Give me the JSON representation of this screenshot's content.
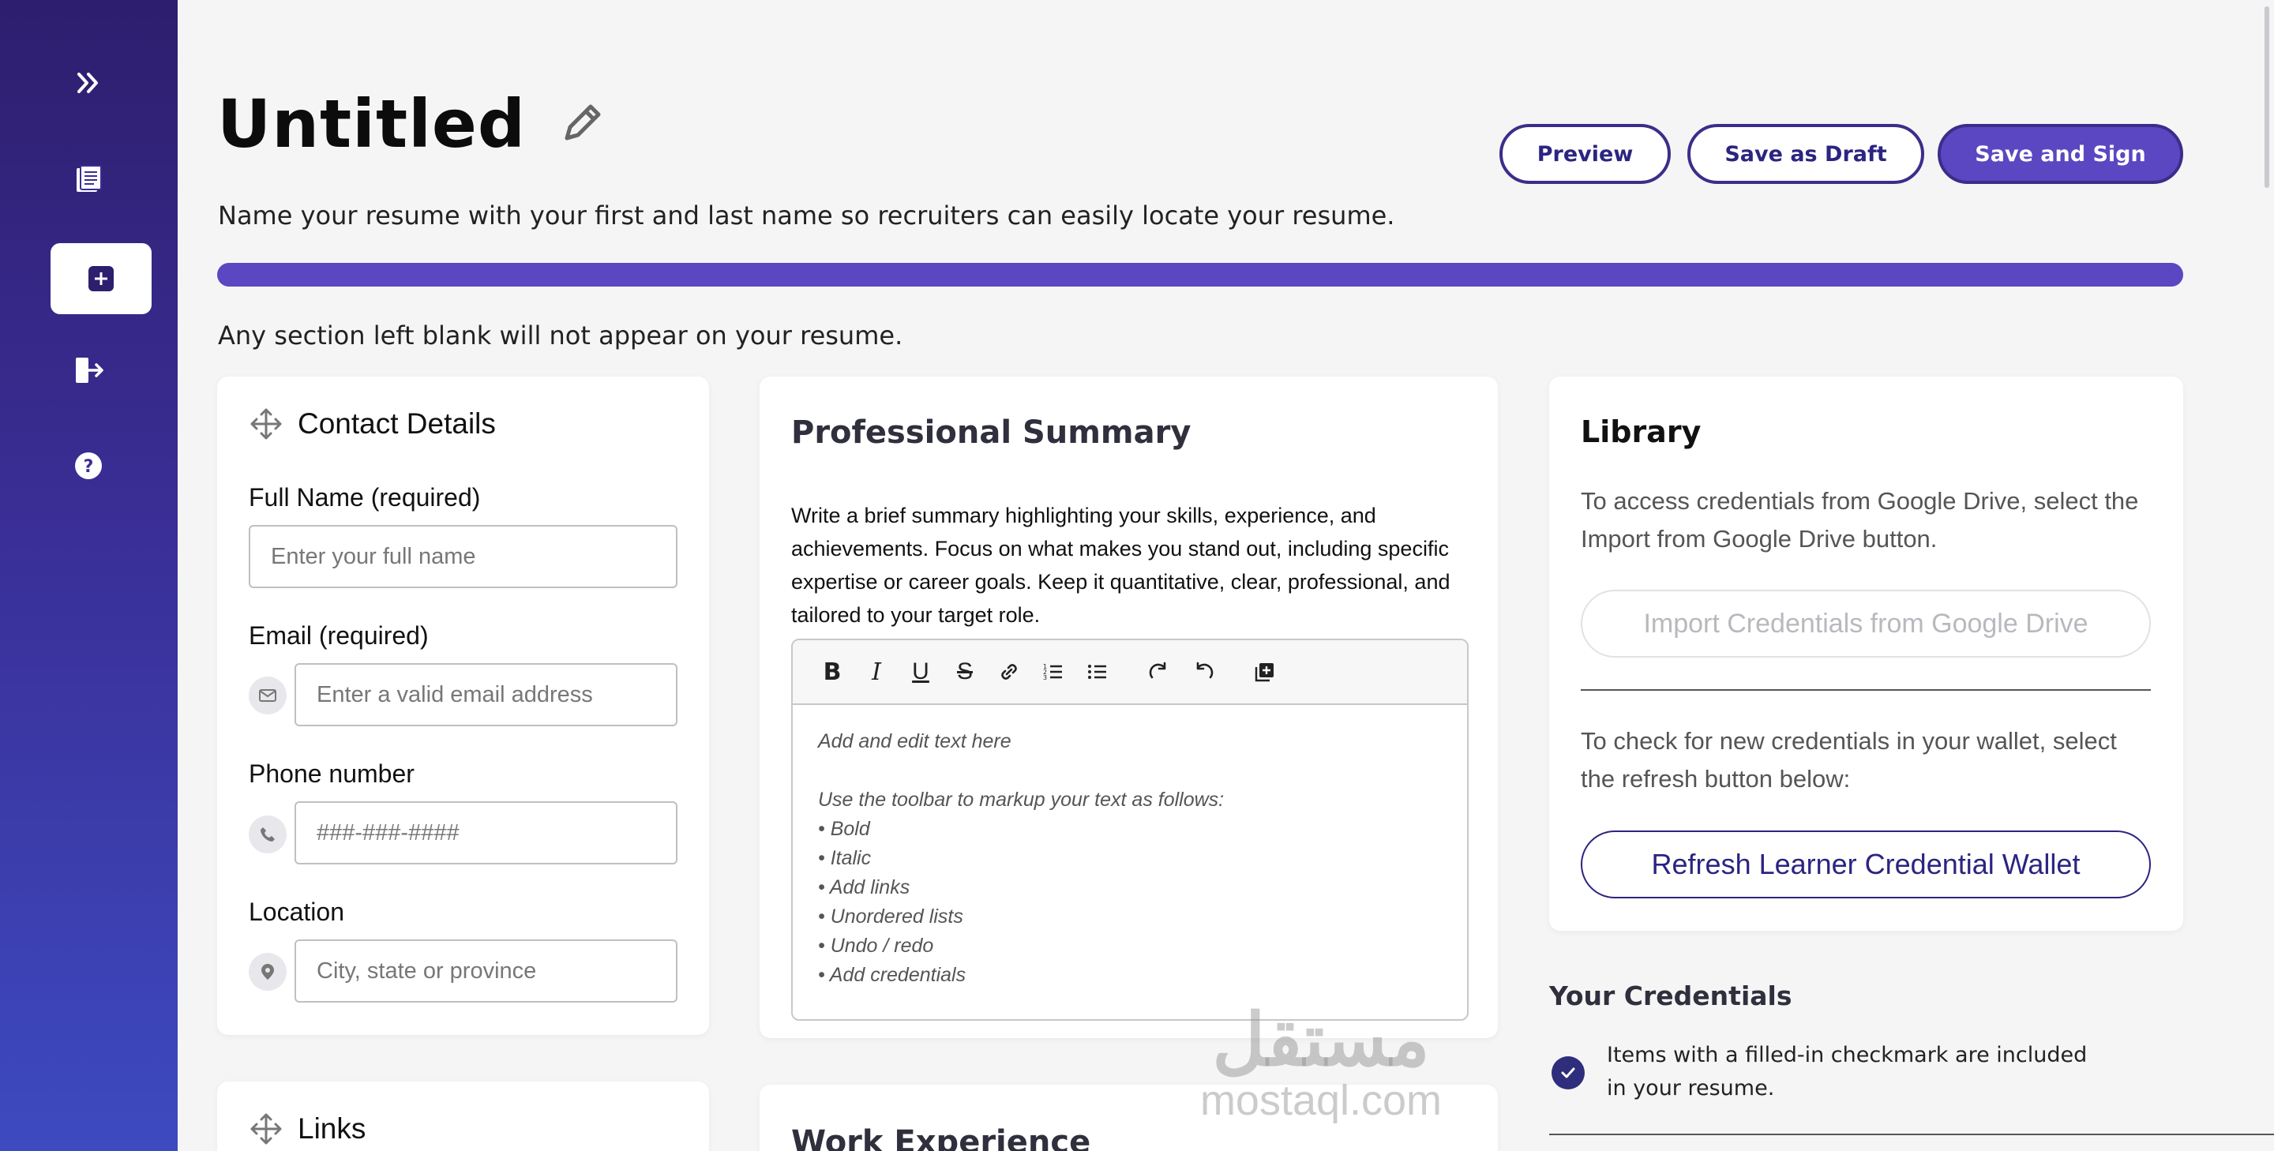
{
  "sidebar": {
    "items": [
      {
        "name": "expand",
        "icon": "double-chevron-right-icon"
      },
      {
        "name": "documents",
        "icon": "document-icon"
      },
      {
        "name": "new-resume",
        "icon": "plus-square-icon",
        "active": true
      },
      {
        "name": "logout",
        "icon": "logout-icon"
      },
      {
        "name": "help",
        "icon": "help-icon"
      }
    ]
  },
  "header": {
    "title": "Untitled",
    "subtitle": "Name your resume with your first and last name so recruiters can easily locate your resume.",
    "notice": "Any section left blank will not appear on your resume.",
    "progress": 1.0,
    "buttons": {
      "preview": "Preview",
      "draft": "Save as Draft",
      "sign": "Save and Sign"
    }
  },
  "contact": {
    "heading": "Contact Details",
    "fields": {
      "name_label": "Full Name (required)",
      "name_placeholder": "Enter your full name",
      "email_label": "Email (required)",
      "email_placeholder": "Enter a valid email address",
      "phone_label": "Phone number",
      "phone_placeholder": "###-###-####",
      "location_label": "Location",
      "location_placeholder": "City, state or province"
    }
  },
  "summary": {
    "heading": "Professional Summary",
    "description": "Write a brief summary highlighting your skills, experience, and achievements. Focus on what makes you stand out, including specific expertise or career goals. Keep it quantitative, clear, professional, and tailored to your target role.",
    "editor_lines": [
      "Add and edit text here",
      "",
      "Use the toolbar to markup your text as follows:",
      "• Bold",
      "• Italic",
      "• Add links",
      "• Unordered lists",
      "• Undo / redo",
      "• Add credentials"
    ]
  },
  "library": {
    "heading": "Library",
    "text1": "To access credentials from Google Drive, select the Import from Google Drive button.",
    "import_label": "Import Credentials from Google Drive",
    "text2": "To check for new credentials in your wallet, select the refresh button below:",
    "refresh_label": "Refresh Learner Credential Wallet"
  },
  "credentials": {
    "heading": "Your Credentials",
    "note": "Items with a filled-in checkmark are included in your resume."
  },
  "links": {
    "heading": "Links"
  },
  "work": {
    "heading": "Work Experience"
  },
  "watermark": {
    "arabic": "مستقل",
    "latin": "mostaql.com"
  },
  "colors": {
    "accent": "#5b47c2",
    "dark_accent": "#2b2480",
    "sidebar_top": "#2e1e6e",
    "sidebar_bottom": "#3d4ac0"
  }
}
